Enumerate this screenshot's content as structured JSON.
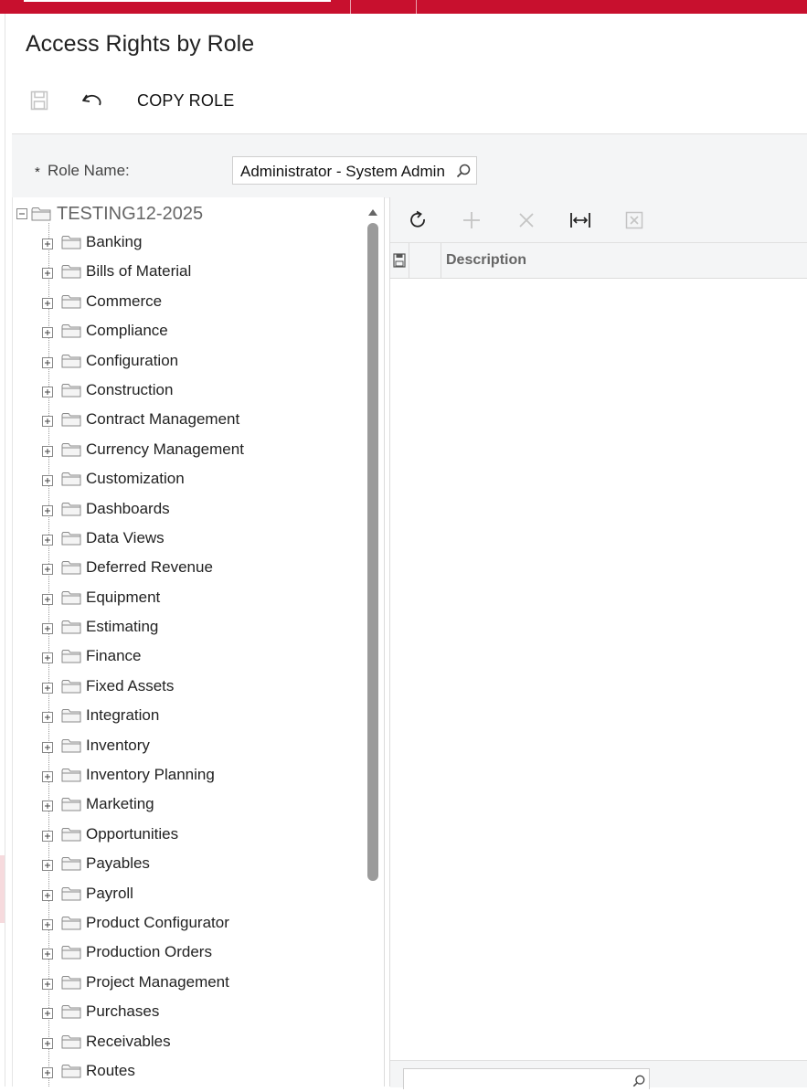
{
  "page": {
    "title": "Access Rights by Role"
  },
  "toolbar": {
    "copy_role_label": "COPY ROLE"
  },
  "form": {
    "required_mark": "*",
    "role_name_label": "Role Name:",
    "role_name_value": "Administrator - System Admin"
  },
  "tree": {
    "root": {
      "label": "TESTING12-2025"
    },
    "items": [
      {
        "label": "Banking"
      },
      {
        "label": "Bills of Material"
      },
      {
        "label": "Commerce"
      },
      {
        "label": "Compliance"
      },
      {
        "label": "Configuration"
      },
      {
        "label": "Construction"
      },
      {
        "label": "Contract Management"
      },
      {
        "label": "Currency Management"
      },
      {
        "label": "Customization"
      },
      {
        "label": "Dashboards"
      },
      {
        "label": "Data Views"
      },
      {
        "label": "Deferred Revenue"
      },
      {
        "label": "Equipment"
      },
      {
        "label": "Estimating"
      },
      {
        "label": "Finance"
      },
      {
        "label": "Fixed Assets"
      },
      {
        "label": "Integration"
      },
      {
        "label": "Inventory"
      },
      {
        "label": "Inventory Planning"
      },
      {
        "label": "Marketing"
      },
      {
        "label": "Opportunities"
      },
      {
        "label": "Payables"
      },
      {
        "label": "Payroll"
      },
      {
        "label": "Product Configurator"
      },
      {
        "label": "Production Orders"
      },
      {
        "label": "Project Management"
      },
      {
        "label": "Purchases"
      },
      {
        "label": "Receivables"
      },
      {
        "label": "Routes"
      }
    ]
  },
  "grid": {
    "columns": {
      "description": "Description"
    }
  },
  "colors": {
    "brand_red": "#c8102e",
    "panel_gray": "#f4f5f6"
  },
  "icons": {
    "save": "save-icon",
    "undo": "undo-icon",
    "search": "search-icon",
    "refresh": "refresh-icon",
    "add": "add-icon",
    "delete": "delete-icon",
    "fit_columns": "fit-columns-icon",
    "export_excel": "excel-export-icon",
    "folder": "folder-icon",
    "expand": "expand-plus-icon",
    "collapse": "collapse-minus-icon"
  }
}
